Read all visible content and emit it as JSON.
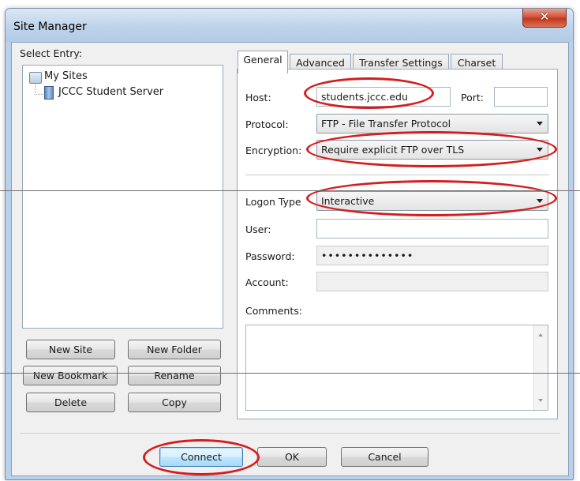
{
  "window": {
    "title": "Site Manager",
    "close_label": "✕"
  },
  "tree": {
    "label": "Select Entry:",
    "root": "My Sites",
    "child": "JCCC Student Server"
  },
  "left_buttons": {
    "new_site": "New Site",
    "new_folder": "New Folder",
    "new_bookmark": "New Bookmark",
    "rename": "Rename",
    "delete": "Delete",
    "copy": "Copy"
  },
  "tabs": [
    "General",
    "Advanced",
    "Transfer Settings",
    "Charset"
  ],
  "form": {
    "host_label": "Host:",
    "host_value": "students.jccc.edu",
    "port_label": "Port:",
    "port_value": "",
    "protocol_label": "Protocol:",
    "protocol_value": "FTP - File Transfer Protocol",
    "encryption_label": "Encryption:",
    "encryption_value": "Require explicit FTP over TLS",
    "logon_label": "Logon Type",
    "logon_value": "Interactive",
    "user_label": "User:",
    "user_value": "",
    "password_label": "Password:",
    "password_value": "••••••••••••••",
    "account_label": "Account:",
    "account_value": "",
    "comments_label": "Comments:"
  },
  "bottom_buttons": {
    "connect": "Connect",
    "ok": "OK",
    "cancel": "Cancel"
  },
  "colors": {
    "annotation": "#d41d1d",
    "title_bar": "#bed3ea",
    "dialog_bg": "#f0f0f0"
  }
}
